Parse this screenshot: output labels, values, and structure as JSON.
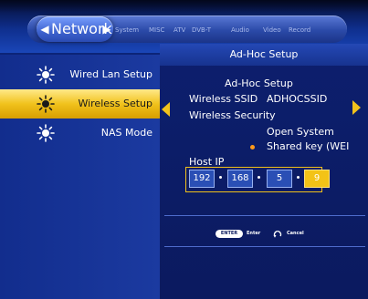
{
  "menu": {
    "current": "Network",
    "tabs": [
      "System",
      "MISC",
      "ATV",
      "DVB-T",
      "Audio",
      "Video",
      "Record"
    ]
  },
  "sidebar": {
    "items": [
      {
        "label": "Wired Lan Setup",
        "icon": "sun-icon"
      },
      {
        "label": "Wireless Setup",
        "icon": "sun-icon"
      },
      {
        "label": "NAS Mode",
        "icon": "sun-icon"
      }
    ],
    "selected_index": 1
  },
  "panel": {
    "title": "Ad-Hoc Setup",
    "subtitle": "Ad-Hoc Setup",
    "ssid_label": "Wireless SSID",
    "ssid_value": "ADHOCSSID",
    "security_label": "Wireless Security",
    "security_options": [
      "Open System",
      "Shared key (WEI"
    ],
    "security_selected_index": 1,
    "host_ip_label": "Host IP",
    "ip_octets": [
      "192",
      "168",
      "5",
      "9"
    ],
    "active_octet_index": 3
  },
  "footer": {
    "enter_button": "ENTER",
    "enter_label": "Enter",
    "cancel_label": "Cancel"
  },
  "colors": {
    "highlight": "#f1c21c",
    "background": "#0b1a5c",
    "selected_dot": "#ff9a1a"
  }
}
